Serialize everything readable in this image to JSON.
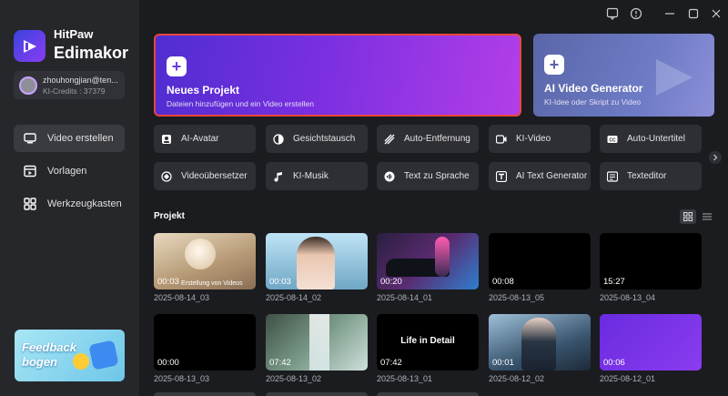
{
  "brand": {
    "line1": "HitPaw",
    "line2": "Edimakor"
  },
  "account": {
    "name": "zhouhongjian@ten...",
    "credits": "KI-Credits : 37379"
  },
  "nav": [
    {
      "label": "Video erstellen",
      "icon": "monitor-icon",
      "active": true
    },
    {
      "label": "Vorlagen",
      "icon": "template-icon",
      "active": false
    },
    {
      "label": "Werkzeugkasten",
      "icon": "toolbox-icon",
      "active": false
    }
  ],
  "feedback": {
    "line1": "Feedback",
    "line2": "bogen"
  },
  "hero": [
    {
      "title": "Neues Projekt",
      "subtitle": "Dateien hinzufügen und ein Video erstellen",
      "icon": "+"
    },
    {
      "title": "AI Video Generator",
      "subtitle": "KI-Idee oder Skript zu Video",
      "icon": "+"
    }
  ],
  "tools": [
    {
      "label": "AI-Avatar",
      "icon": "avatar-icon"
    },
    {
      "label": "Gesichtstausch",
      "icon": "face-swap-icon"
    },
    {
      "label": "Auto-Entfernung",
      "icon": "remove-icon"
    },
    {
      "label": "KI-Video",
      "icon": "ai-video-icon"
    },
    {
      "label": "Auto-Untertitel",
      "icon": "cc-icon"
    },
    {
      "label": "Videoübersetzer",
      "icon": "translate-icon"
    },
    {
      "label": "KI-Musik",
      "icon": "music-icon"
    },
    {
      "label": "Text zu Sprache",
      "icon": "tts-icon"
    },
    {
      "label": "AI Text Generator",
      "icon": "text-generator-icon"
    },
    {
      "label": "Texteditor",
      "icon": "text-editor-icon"
    }
  ],
  "projects_title": "Projekt",
  "projects": [
    {
      "duration": "00:03",
      "name": "2025-08-14_03",
      "overlay": "Erstellung von Videos"
    },
    {
      "duration": "00:03",
      "name": "2025-08-14_02",
      "overlay": ""
    },
    {
      "duration": "00:20",
      "name": "2025-08-14_01",
      "overlay": ""
    },
    {
      "duration": "00:08",
      "name": "2025-08-13_05",
      "overlay": ""
    },
    {
      "duration": "15:27",
      "name": "2025-08-13_04",
      "overlay": ""
    },
    {
      "duration": "00:00",
      "name": "2025-08-13_03",
      "overlay": ""
    },
    {
      "duration": "07:42",
      "name": "2025-08-13_02",
      "overlay": ""
    },
    {
      "duration": "07:42",
      "name": "2025-08-13_01",
      "overlay": "Life in Detail"
    },
    {
      "duration": "00:01",
      "name": "2025-08-12_02",
      "overlay": ""
    },
    {
      "duration": "00:06",
      "name": "2025-08-12_01",
      "overlay": ""
    }
  ],
  "colors": {
    "accent": "#7a2fe0",
    "selection_border": "#e8463c",
    "background": "#1b1c20",
    "sidebar": "#26272b"
  }
}
